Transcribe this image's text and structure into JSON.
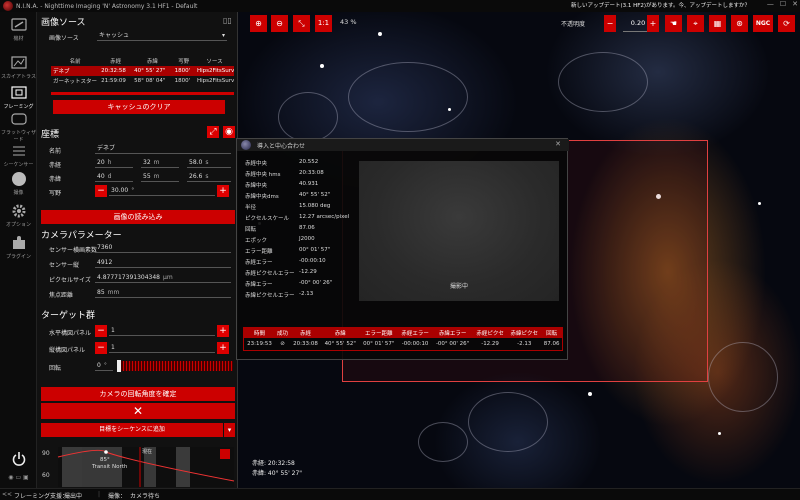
{
  "titlebar": {
    "title": "N.I.N.A. - Nighttime Imaging 'N' Astronomy 3.1 HF1 - Default",
    "update_notice": "新しいアップデート(3.1 HF2)があります。今、アップデートしますか？"
  },
  "nav": {
    "items": [
      {
        "label": "機材",
        "icon": "telescope-icon"
      },
      {
        "label": "スカイアトラス",
        "icon": "atlas-icon"
      },
      {
        "label": "フレーミング",
        "icon": "framing-icon"
      },
      {
        "label": "フラットウィザード",
        "icon": "flat-icon"
      },
      {
        "label": "シーケンサー",
        "icon": "list-icon"
      },
      {
        "label": "撮像",
        "icon": "imaging-icon"
      },
      {
        "label": "オプション",
        "icon": "gear-icon"
      },
      {
        "label": "プラグイン",
        "icon": "puzzle-icon"
      }
    ]
  },
  "panel": {
    "image_source_title": "画像ソース",
    "image_source_label": "画像ソース",
    "image_source_value": "キャッシュ",
    "table_headers": [
      "名前",
      "赤経",
      "赤緯",
      "写野",
      "ソース"
    ],
    "table_rows": [
      [
        "デネブ",
        "20:32:58",
        "40° 55' 27\"",
        "1800'",
        "Hips2FitsSurvey"
      ],
      [
        "ガーネットスター",
        "21:59:09",
        "58° 08' 04\"",
        "1800'",
        "Hips2FitsSurvey"
      ]
    ],
    "clear_cache_button": "キャッシュのクリア",
    "coordinates_title": "座標",
    "name_label": "名前",
    "name_value": "デネブ",
    "ra_label": "赤経",
    "ra_h": "20",
    "ra_h_unit": "h",
    "ra_m": "32",
    "ra_m_unit": "m",
    "ra_s": "58.0",
    "ra_s_unit": "s",
    "dec_label": "赤緯",
    "dec_d": "40",
    "dec_d_unit": "d",
    "dec_m": "55",
    "dec_m_unit": "m",
    "dec_s": "26.6",
    "dec_s_unit": "s",
    "fov_label": "写野",
    "fov_value": "30.00",
    "fov_unit": "°",
    "load_image_button": "画像の読み込み",
    "camera_title": "カメラパラメーター",
    "sensor_width_label": "センサー横画素数",
    "sensor_width_value": "7360",
    "sensor_height_label": "センサー縦",
    "sensor_height_value": "4912",
    "pixel_size_label": "ピクセルサイズ",
    "pixel_size_value": "4.877717391304348",
    "pixel_size_unit": "μm",
    "focal_length_label": "焦点距離",
    "focal_length_value": "85",
    "focal_length_unit": "mm",
    "target_title": "ターゲット群",
    "h_panels_label": "水平構図パネル",
    "h_panels_value": "1",
    "v_panels_label": "縦構図パネル",
    "v_panels_value": "1",
    "rotation_label": "回転",
    "rotation_value": "0",
    "rotation_unit": "°",
    "confirm_rotation_button": "カメラの回転角度を確定",
    "add_sequence_button": "目標をシーケンスに追加",
    "chart": {
      "y_ticks": [
        "90",
        "60"
      ],
      "marker_value": "85°",
      "marker_label": "Transit North",
      "now_label": "現在"
    }
  },
  "toolbar": {
    "scale_1to1": "1:1",
    "zoom": "43 %",
    "opacity_label": "不透明度",
    "opacity_value": "0.20",
    "ngc_button": "NGC"
  },
  "dialog": {
    "title": "導入と中心合わせ",
    "close": "✕",
    "rows": [
      {
        "k": "赤経中央",
        "v": "20.552"
      },
      {
        "k": "赤経中央 hms",
        "v": "20:33:08"
      },
      {
        "k": "赤緯中央",
        "v": "40.931"
      },
      {
        "k": "赤緯中央dms",
        "v": "40° 55' 52\""
      },
      {
        "k": "半径",
        "v": "15.080 deg"
      },
      {
        "k": "ピクセルスケール",
        "v": "12.27 arcsec/pixel"
      },
      {
        "k": "回転",
        "v": "87.06"
      },
      {
        "k": "エポック",
        "v": "J2000"
      },
      {
        "k": "エラー距離",
        "v": "00° 01' 57\""
      },
      {
        "k": "赤経エラー",
        "v": "-00:00:10"
      },
      {
        "k": "赤経ピクセルエラー",
        "v": "-12.29"
      },
      {
        "k": "赤緯エラー",
        "v": "-00° 00' 26\""
      },
      {
        "k": "赤緯ピクセルエラー",
        "v": "-2.13"
      }
    ],
    "status": "撮影中",
    "result_headers": [
      "時間",
      "成功",
      "赤経",
      "赤緯",
      "エラー距離",
      "赤経エラー",
      "赤緯エラー",
      "赤経ピクセ",
      "赤緯ピクセ",
      "回転"
    ],
    "result_row": [
      "23:19:53",
      "⊘",
      "20:33:08",
      "40° 55' 52\"",
      "00° 01' 57\"",
      "-00:00:10",
      "-00° 00' 26\"",
      "-12.29",
      "-2.13",
      "87.06"
    ]
  },
  "main": {
    "ra_readout": "赤経: 20:32:58",
    "dec_readout": "赤緯: 40° 55' 27\""
  },
  "statusbar": {
    "framing_label": "フレーミング支援：",
    "framing_value": "撮出中",
    "imaging_label": "撮像：",
    "imaging_value": "カメラ待ち"
  },
  "colors": {
    "accent": "#cc0000",
    "fov_border": "#e04040"
  }
}
